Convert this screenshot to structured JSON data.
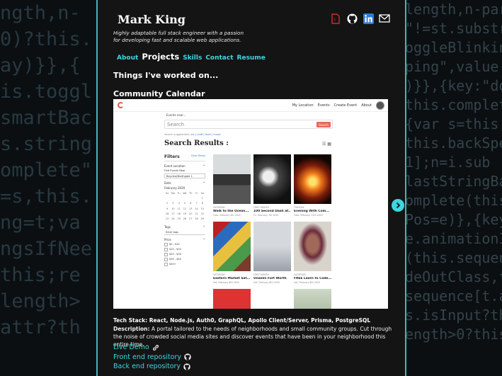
{
  "header": {
    "name": "Mark King",
    "tagline": "Highly adaptable full stack engineer with a passion for developing fast and scalable web applications."
  },
  "nav": {
    "about": "About",
    "projects": "Projects",
    "skills": "Skills",
    "contact": "Contact",
    "resume": "Resume"
  },
  "section_title": "Things I've worked on...",
  "project": {
    "title": "Community Calendar",
    "tech_stack": "Tech Stack: React, Node.js, Auth0, GraphQL, Apollo Client/Server, Prisma, PostgreSQL",
    "description_label": "Description:",
    "description": "A portal tailored to the needs of neighborhoods and small community groups. Cut through the noise of crowded social media sites and discover events that have been in your neighborhood this entire time.",
    "live_demo": "Live Demo",
    "frontend_repo": "Front end repository",
    "backend_repo": "Back end repository"
  },
  "preview": {
    "menu": [
      "My Location",
      "Events",
      "Create Event",
      "About"
    ],
    "near": "Events near...",
    "search_placeholder": "Search",
    "search_button": "Search",
    "suggest_label": "Search suggestions:",
    "suggest_links": "art | craft | food | music",
    "results_heading": "Search Results :",
    "filters": {
      "title": "Filters",
      "clear": "Clear filters",
      "location_label": "Event Location",
      "location_hint": "Find Events Near",
      "location_value": "Bayview/Northgate 1",
      "date_label": "Date",
      "month": "February 2020",
      "tags_label": "Tags",
      "tags_placeholder": "Enter tags",
      "price_label": "Price",
      "prices": [
        "$0 - $10",
        "$10 - $20",
        "$20 - $30",
        "$30 - $40",
        "$40+"
      ]
    },
    "cards": [
      {
        "date": "SATURDAY",
        "title": "Walk to the Ocean...",
        "sub": "Tues, February 4th 2020"
      },
      {
        "date": "FIRST MONTH",
        "title": "100 Second Dash at...",
        "sub": "Fri, February 7th 2020"
      },
      {
        "date": "TUESDAY",
        "title": "Evening With Com...",
        "sub": "Tues, February 11th 2020"
      },
      {
        "date": "SATURDAY",
        "title": "Eastern Market Sat...",
        "sub": "Sat, February 8th 2020"
      },
      {
        "date": "FIRST MONTH",
        "title": "Unseen Fort Worth",
        "sub": "Sat, February 8th 2020"
      },
      {
        "date": "SATURDAY",
        "title": "FREE Learn to Code...",
        "sub": "Sat, February 8th 2020"
      }
    ]
  },
  "colors": {
    "accent": "#3fd6e0",
    "panel": "#141414",
    "border": "#3fb6c2"
  }
}
